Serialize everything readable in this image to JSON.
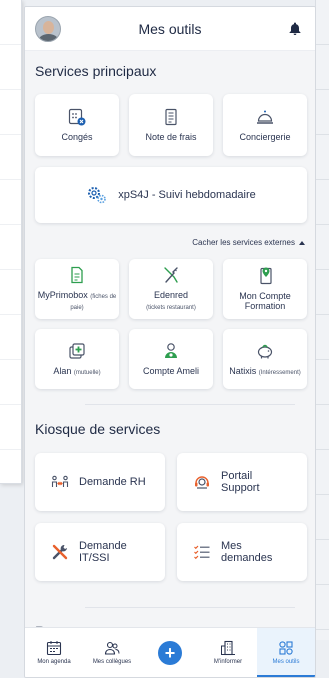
{
  "header": {
    "title": "Mes outils"
  },
  "sections": {
    "main": "Services principaux",
    "kiosk": "Kiosque de services",
    "resources": "Ressources"
  },
  "principal": [
    {
      "label": "Congés",
      "icon": "calendar-x-icon"
    },
    {
      "label": "Note de frais",
      "icon": "receipt-icon"
    },
    {
      "label": "Conciergerie",
      "icon": "cloche-icon"
    }
  ],
  "xps4j": {
    "label": "xpS4J - Suivi hebdomadaire",
    "icon": "gears-icon"
  },
  "toggle_external": "Cacher les services externes",
  "external": [
    {
      "label": "MyPrimobox",
      "sub": "(fiches de paie)",
      "icon": "document-icon"
    },
    {
      "label": "Edenred",
      "sub": "(tickets restaurant)",
      "icon": "utensils-icon"
    },
    {
      "label": "Mon Compte Formation",
      "sub": "",
      "icon": "location-book-icon"
    },
    {
      "label": "Alan",
      "sub": "(mutuelle)",
      "icon": "medical-cross-icon"
    },
    {
      "label": "Compte Ameli",
      "sub": "",
      "icon": "person-icon"
    },
    {
      "label": "Natixis",
      "sub": "(Intéressement)",
      "icon": "piggy-bank-icon"
    }
  ],
  "kiosk": [
    {
      "label": "Demande RH",
      "icon": "people-arrows-icon"
    },
    {
      "label": "Portail Support",
      "icon": "headset-icon"
    },
    {
      "label": "Demande IT/SSI",
      "icon": "tools-icon"
    },
    {
      "label": "Mes demandes",
      "icon": "checklist-icon"
    }
  ],
  "nav": [
    {
      "label": "Mon agenda",
      "icon": "calendar-icon"
    },
    {
      "label": "Mes collègues",
      "icon": "users-icon"
    },
    {
      "label": "",
      "icon": "plus-icon"
    },
    {
      "label": "M'informer",
      "icon": "building-icon"
    },
    {
      "label": "Mes outils",
      "icon": "grid-icon",
      "active": true
    }
  ],
  "colors": {
    "accent": "#2b7bd6",
    "green": "#2e9e4f",
    "orange": "#e8602c"
  }
}
